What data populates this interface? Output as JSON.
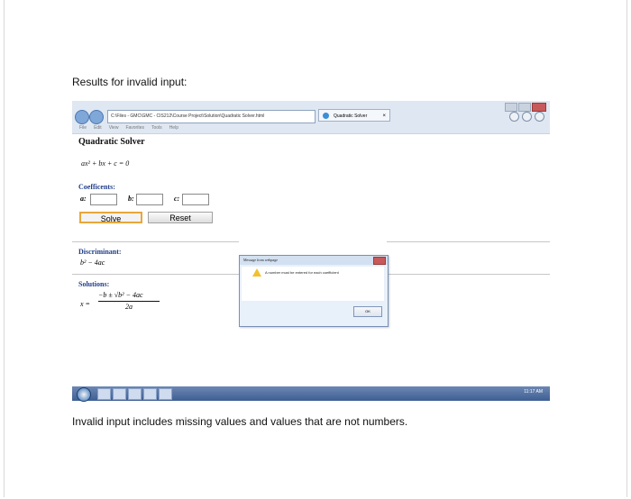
{
  "heading": "Results for invalid input:",
  "footer_note": "Invalid input includes missing values and values that are not numbers.",
  "browser": {
    "address": "C:\\Files - GMC\\GMC - CIS212\\Course Project\\Solution\\Quadratic Solver.html",
    "tab_title": "Quadratic Solver",
    "tab_close": "×",
    "menu": [
      "File",
      "Edit",
      "View",
      "Favorites",
      "Tools",
      "Help"
    ]
  },
  "app": {
    "title": "Quadratic Solver",
    "formula": "ax² + bx + c = 0",
    "coefficients_label": "Coefficents:",
    "a_label": "a:",
    "b_label": "b:",
    "c_label": "c:",
    "a_value": "",
    "b_value": "",
    "c_value": "",
    "solve_label": "Solve",
    "reset_label": "Reset",
    "discriminant_label": "Discriminant:",
    "discriminant_expr": "b² − 4ac",
    "solutions_label": "Solutions:",
    "solution_lhs": "x =",
    "solution_numerator": "−b ± √b² − 4ac",
    "solution_denominator": "2a"
  },
  "dialog": {
    "title": "Message from webpage",
    "message": "A number must be entered for each coefficient",
    "ok_label": "OK"
  },
  "taskbar": {
    "clock": "11:17 AM"
  }
}
